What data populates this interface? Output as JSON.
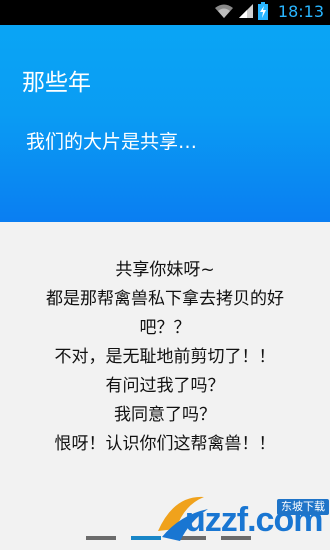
{
  "status_bar": {
    "time": "18:13",
    "icons": [
      "wifi-icon",
      "signal-icon",
      "battery-charging-icon"
    ],
    "accent": "#29b5ff"
  },
  "hero": {
    "title": "那些年",
    "subtitle": "我们的大片是共享…",
    "gradient_top": "#0aa5f5",
    "gradient_bottom": "#0a7ef2"
  },
  "content": {
    "lines": [
      "共享你妹呀~",
      "都是那帮禽兽私下拿去拷贝的好",
      "吧？？",
      "不对，是无耻地前剪切了！！",
      "有问过我了吗？",
      "我同意了吗？",
      "恨呀！认识你们这帮禽兽！！"
    ]
  },
  "pager": {
    "page_count": 4,
    "active_index": 1,
    "active_color": "#1886c7"
  },
  "watermark": {
    "logo_text": "uzzf.com",
    "badge_text": "东坡下载"
  }
}
